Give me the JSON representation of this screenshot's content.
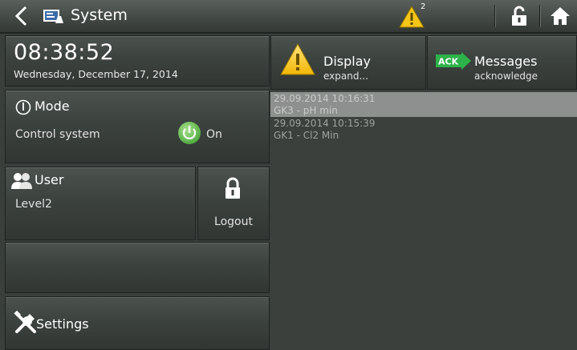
{
  "header": {
    "title": "System",
    "warning_count": "2",
    "icons": [
      "back-arrow-icon",
      "system-icon",
      "warning-icon",
      "unlocked-icon",
      "home-icon"
    ]
  },
  "clock": {
    "time": "08:38:52",
    "date": "Wednesday, December 17, 2014"
  },
  "mode": {
    "title": "Mode",
    "label": "Control system",
    "state": "On",
    "state_color": "#5cbf4a"
  },
  "user": {
    "title": "User",
    "level": "Level2",
    "logout_label": "Logout"
  },
  "settings": {
    "label": "Settings"
  },
  "display_button": {
    "title": "Display",
    "subtitle": "expand..."
  },
  "messages_button": {
    "title": "Messages",
    "subtitle": "acknowledge",
    "badge": "ACK",
    "badge_color": "#2db34a"
  },
  "messages": [
    {
      "timestamp": "29.09.2014 10:16:31",
      "text": "GK3 - pH min",
      "selected": true
    },
    {
      "timestamp": "29.09.2014 10:15:39",
      "text": "GK1 - Cl2 Min",
      "selected": false
    }
  ],
  "colors": {
    "background": "#3a3f3c",
    "warning": "#f5c518",
    "selected_row": "#8e908f"
  }
}
